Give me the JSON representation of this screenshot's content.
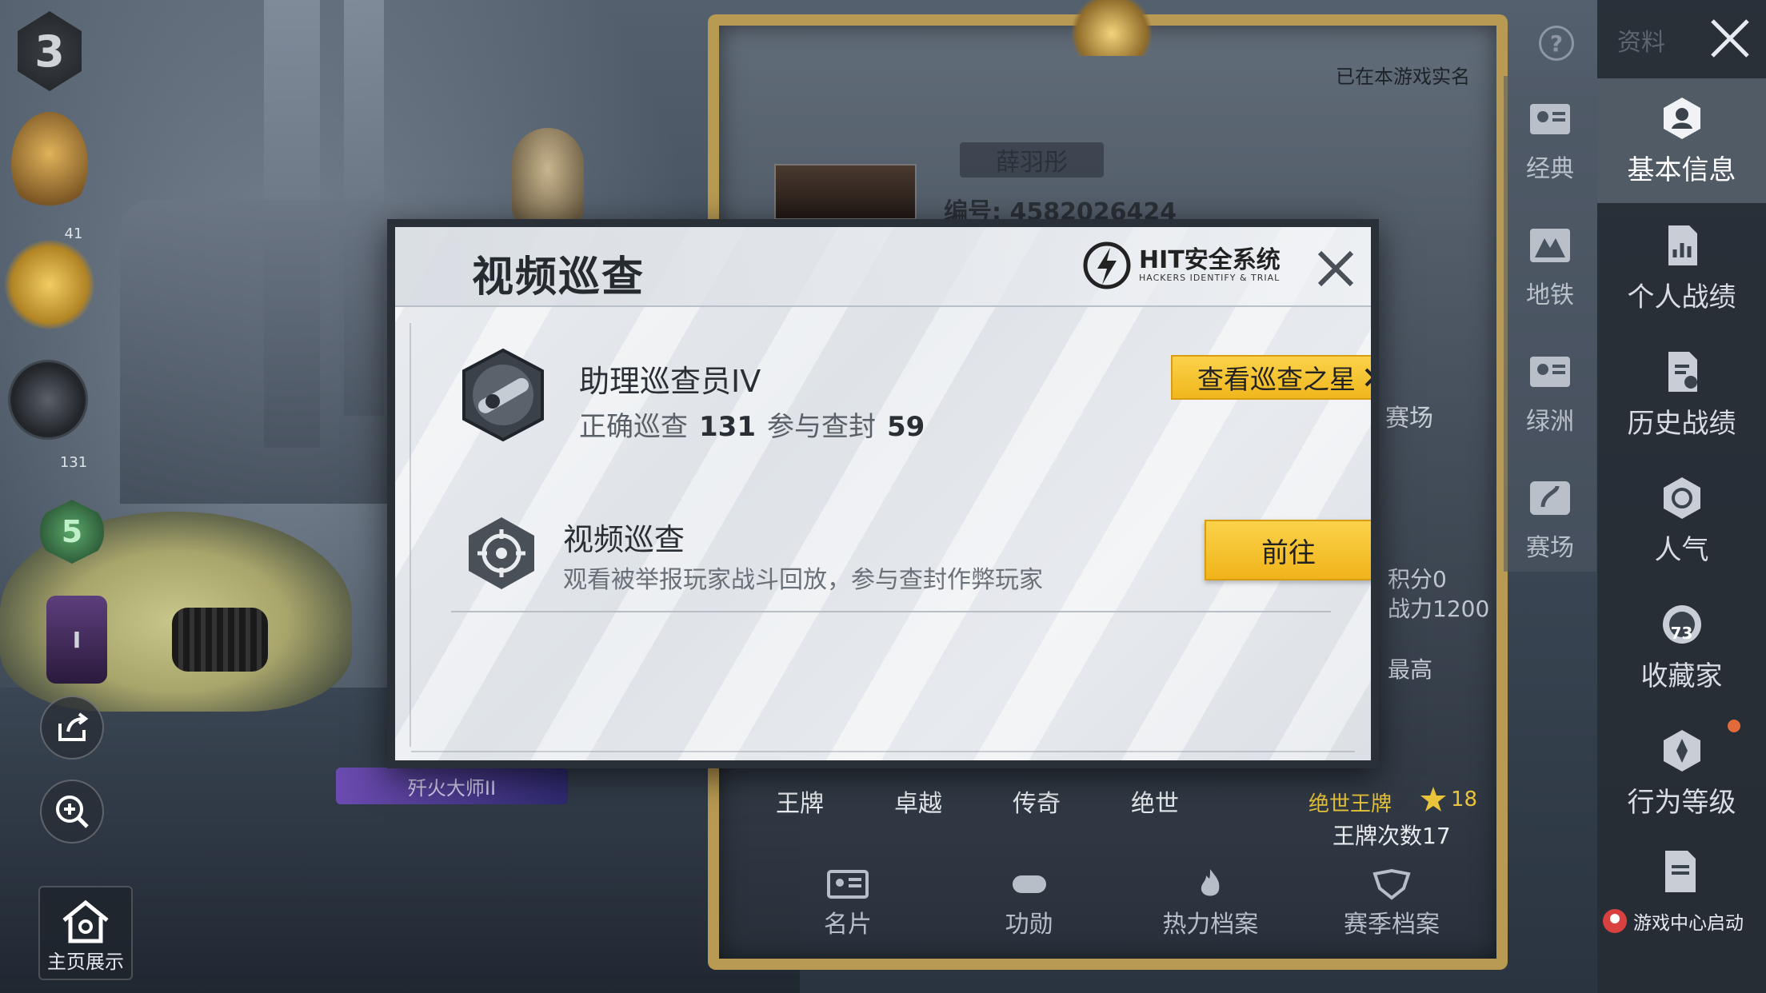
{
  "background": {
    "left_badges": {
      "rank_level": "3",
      "fire_badge_count": "41",
      "scope_badge_count": "131",
      "green_badge_level": "5"
    },
    "home_button": "主页展示",
    "title_chip": "歼火大师II"
  },
  "profile": {
    "verified_text": "已在本游戏实名",
    "player_name": "薛羽彤",
    "player_id": "编号: 4582026424",
    "ghost_ranked": "赛场",
    "ghost_points": "积分0",
    "ghost_power": "战力1200",
    "ghost_highest": "最高",
    "tiers": [
      "王牌",
      "卓越",
      "传奇",
      "绝世"
    ],
    "ace_title": "绝世王牌",
    "ace_count": "18",
    "ace_times": "王牌次数17",
    "bottom_tabs": [
      {
        "label": "名片",
        "icon": "card-icon"
      },
      {
        "label": "功勋",
        "icon": "medal-icon"
      },
      {
        "label": "热力档案",
        "icon": "flame-icon"
      },
      {
        "label": "赛季档案",
        "icon": "season-icon"
      }
    ]
  },
  "topbar": {
    "title": "资料"
  },
  "mode_nav": [
    {
      "label": "经典",
      "icon": "classic-mode-icon"
    },
    {
      "label": "地铁",
      "icon": "metro-mode-icon"
    },
    {
      "label": "绿洲",
      "icon": "oasis-mode-icon"
    },
    {
      "label": "赛场",
      "icon": "arena-mode-icon"
    }
  ],
  "right_nav": [
    {
      "label": "基本信息",
      "icon": "profile-icon",
      "active": true
    },
    {
      "label": "个人战绩",
      "icon": "stats-icon"
    },
    {
      "label": "历史战绩",
      "icon": "history-icon"
    },
    {
      "label": "人气",
      "icon": "popularity-icon"
    },
    {
      "label": "收藏家",
      "icon": "collector-icon",
      "badge": "73"
    },
    {
      "label": "行为等级",
      "icon": "behavior-icon"
    }
  ],
  "game_center": "游戏中心启动",
  "modal": {
    "title": "视频巡查",
    "logo": {
      "name": "HIT安全系统",
      "subtitle": "HACKERS IDENTIFY & TRIAL"
    },
    "rank_name": "助理巡查员IV",
    "stats": {
      "correct_label": "正确巡查",
      "correct_value": "131",
      "ban_label": "参与查封",
      "ban_value": "59"
    },
    "star_button": "查看巡查之星",
    "task": {
      "title": "视频巡查",
      "description": "观看被举报玩家战斗回放，参与查封作弊玩家",
      "button": "前往"
    }
  },
  "colors": {
    "accent_yellow": "#f0b71c",
    "frame_gold": "#b89a52",
    "panel_dark": "#262c34"
  }
}
